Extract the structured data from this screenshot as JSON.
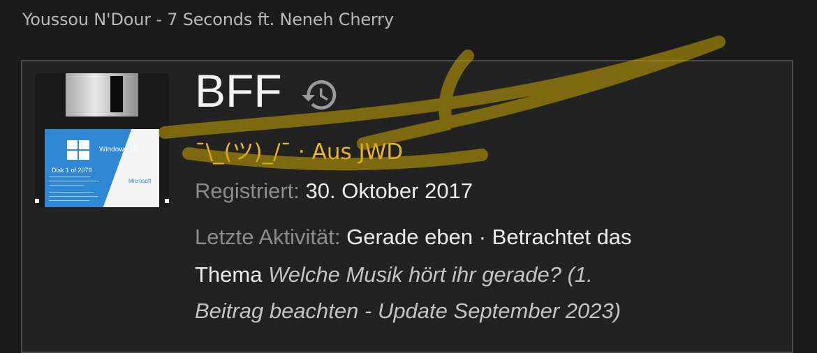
{
  "now_playing": "Youssou N'Dour - 7 Seconds ft. Neneh Cherry",
  "profile": {
    "username": "BFF",
    "history_icon": "history-icon",
    "user_title": "¯\\_(ツ)_/¯ · Aus JWD",
    "registered_label": "Registriert:",
    "registered_value": "30. Oktober 2017",
    "activity_label": "Letzte Aktivität:",
    "activity_value": "Gerade eben · Betrachtet das",
    "activity_value_2": "Thema",
    "activity_topic_1": "Welche Musik hört ihr gerade? (1.",
    "activity_topic_2": "Beitrag beachten - Update September 2023)"
  },
  "avatar": {
    "label_title": "Windows 10",
    "label_disk": "Disk 1 of 2079",
    "label_brand": "Microsoft"
  },
  "colors": {
    "title_gold": "#e8b52c",
    "scribble": "#c9a400"
  }
}
